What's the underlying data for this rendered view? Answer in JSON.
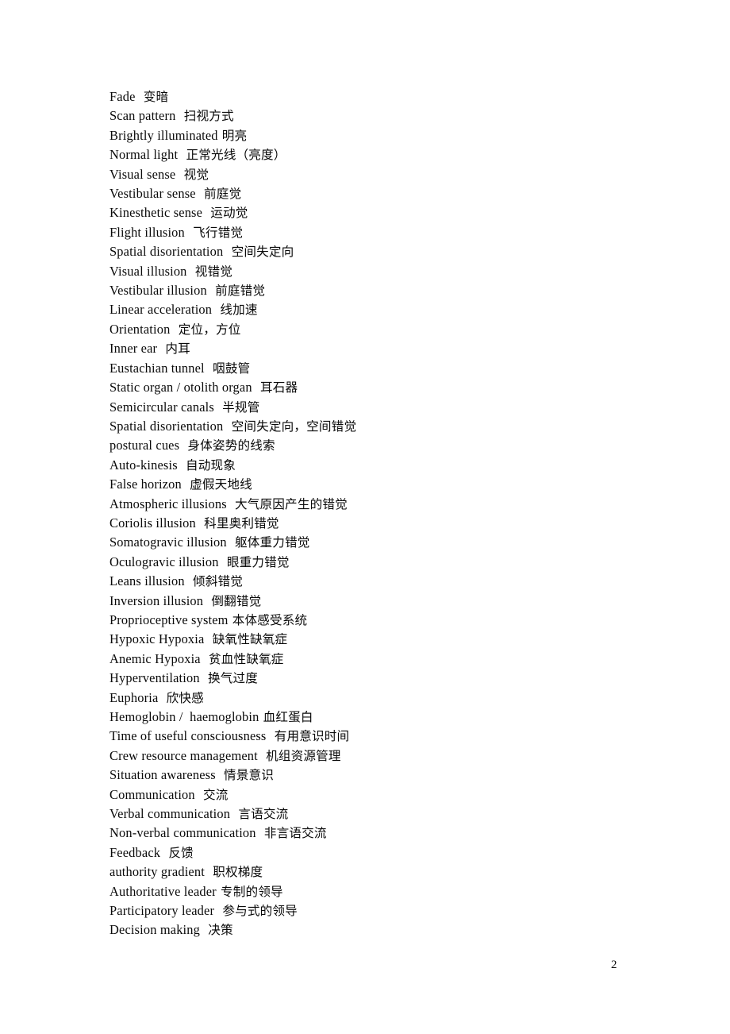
{
  "page": {
    "number": "2",
    "background_color": "#ffffff",
    "text_color": "#0a0a0a"
  },
  "glossary": {
    "entries": [
      {
        "en": "Fade",
        "zh": "变暗",
        "gap": "wide"
      },
      {
        "en": "Scan pattern",
        "zh": "扫视方式",
        "gap": "wide"
      },
      {
        "en": "Brightly illuminated",
        "zh": "明亮",
        "gap": "narrow"
      },
      {
        "en": "Normal light",
        "zh": "正常光线（亮度）",
        "gap": "wide"
      },
      {
        "en": "Visual sense",
        "zh": "视觉",
        "gap": "wide"
      },
      {
        "en": "Vestibular sense",
        "zh": "前庭觉",
        "gap": "wide"
      },
      {
        "en": "Kinesthetic sense",
        "zh": "运动觉",
        "gap": "wide"
      },
      {
        "en": "Flight illusion",
        "zh": "飞行错觉",
        "gap": "wide"
      },
      {
        "en": "Spatial disorientation",
        "zh": "空间失定向",
        "gap": "wide"
      },
      {
        "en": "Visual illusion",
        "zh": "视错觉",
        "gap": "wide"
      },
      {
        "en": "Vestibular illusion",
        "zh": "前庭错觉",
        "gap": "wide"
      },
      {
        "en": "Linear acceleration",
        "zh": "线加速",
        "gap": "wide"
      },
      {
        "en": "Orientation",
        "zh": "定位，方位",
        "gap": "wide"
      },
      {
        "en": "Inner ear",
        "zh": "内耳",
        "gap": "wide"
      },
      {
        "en": "Eustachian tunnel",
        "zh": "咽鼓管",
        "gap": "wide"
      },
      {
        "en": "Static organ / otolith organ",
        "zh": "耳石器",
        "gap": "wide"
      },
      {
        "en": "Semicircular canals",
        "zh": "半规管",
        "gap": "wide"
      },
      {
        "en": "Spatial disorientation",
        "zh": "空间失定向，空间错觉",
        "gap": "wide"
      },
      {
        "en": "postural cues",
        "zh": "身体姿势的线索",
        "gap": "wide"
      },
      {
        "en": "Auto-kinesis",
        "zh": "自动现象",
        "gap": "wide"
      },
      {
        "en": "False horizon",
        "zh": "虚假天地线",
        "gap": "wide"
      },
      {
        "en": "Atmospheric illusions",
        "zh": "大气原因产生的错觉",
        "gap": "wide"
      },
      {
        "en": "Coriolis illusion",
        "zh": "科里奥利错觉",
        "gap": "wide"
      },
      {
        "en": "Somatogravic illusion",
        "zh": "躯体重力错觉",
        "gap": "wide"
      },
      {
        "en": "Oculogravic illusion",
        "zh": "眼重力错觉",
        "gap": "wide"
      },
      {
        "en": "Leans illusion",
        "zh": "倾斜错觉",
        "gap": "wide"
      },
      {
        "en": "Inversion illusion",
        "zh": "倒翻错觉",
        "gap": "wide"
      },
      {
        "en": "Proprioceptive system",
        "zh": "本体感受系统",
        "gap": "narrow"
      },
      {
        "en": "Hypoxic Hypoxia",
        "zh": "缺氧性缺氧症",
        "gap": "wide"
      },
      {
        "en": "Anemic Hypoxia",
        "zh": "贫血性缺氧症",
        "gap": "wide"
      },
      {
        "en": "Hyperventilation",
        "zh": "换气过度",
        "gap": "wide"
      },
      {
        "en": "Euphoria",
        "zh": "欣快感",
        "gap": "wide"
      },
      {
        "en": "Hemoglobin /  haemoglobin",
        "zh": "血红蛋白",
        "gap": "narrow"
      },
      {
        "en": "Time of useful consciousness",
        "zh": "有用意识时间",
        "gap": "wide"
      },
      {
        "en": "Crew resource management",
        "zh": "机组资源管理",
        "gap": "wide"
      },
      {
        "en": "Situation awareness",
        "zh": "情景意识",
        "gap": "wide"
      },
      {
        "en": "Communication",
        "zh": "交流",
        "gap": "wide"
      },
      {
        "en": "Verbal communication",
        "zh": "言语交流",
        "gap": "wide"
      },
      {
        "en": "Non-verbal communication",
        "zh": "非言语交流",
        "gap": "wide"
      },
      {
        "en": "Feedback",
        "zh": "反馈",
        "gap": "wide"
      },
      {
        "en": "authority gradient",
        "zh": "职权梯度",
        "gap": "wide"
      },
      {
        "en": "Authoritative leader",
        "zh": "专制的领导",
        "gap": "narrow"
      },
      {
        "en": "Participatory leader",
        "zh": "参与式的领导",
        "gap": "wide"
      },
      {
        "en": "Decision making",
        "zh": "决策",
        "gap": "wide"
      }
    ]
  }
}
